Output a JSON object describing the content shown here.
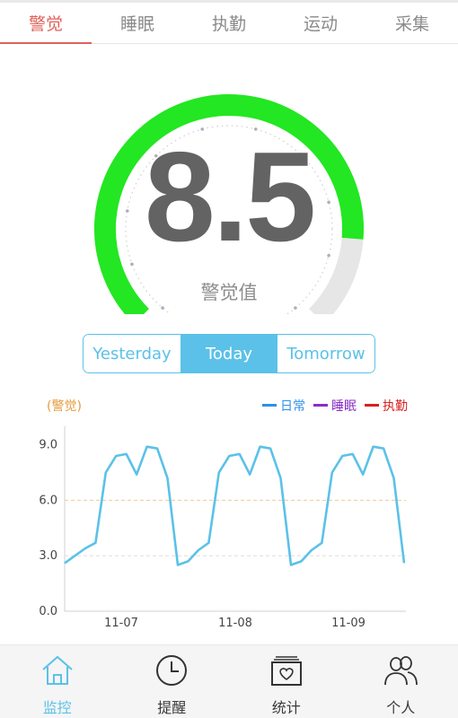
{
  "tabs": [
    {
      "label": "警觉",
      "active": true
    },
    {
      "label": "睡眠",
      "active": false
    },
    {
      "label": "执勤",
      "active": false
    },
    {
      "label": "运动",
      "active": false
    },
    {
      "label": "采集",
      "active": false
    }
  ],
  "gauge": {
    "value": "8.5",
    "value_fraction": 0.85,
    "label": "警觉值",
    "fill_color": "#22e722",
    "track_color": "#e6e6e6"
  },
  "day_selector": {
    "options": [
      "Yesterday",
      "Today",
      "Tomorrow"
    ],
    "selected": "Today"
  },
  "chart_data": {
    "type": "line",
    "ylabel": "(警觉)",
    "ylim": [
      0,
      10
    ],
    "yticks": [
      "9.0",
      "6.0",
      "3.0",
      "0.0"
    ],
    "ytick_values": [
      9,
      6,
      3,
      0
    ],
    "xticks": [
      "11-07",
      "11-08",
      "11-09"
    ],
    "threshold_lines": [
      6.0,
      3.0
    ],
    "legend_position": "top-right",
    "series": [
      {
        "name": "日常",
        "color": "#2f8fe6"
      },
      {
        "name": "睡眠",
        "color": "#8a2ec6"
      },
      {
        "name": "执勤",
        "color": "#d62020"
      }
    ],
    "line_color": "#5bc1e8",
    "values": [
      2.6,
      3.0,
      3.4,
      3.7,
      7.5,
      8.4,
      8.5,
      7.4,
      8.9,
      8.8,
      7.2,
      2.5,
      2.7,
      3.3,
      3.7,
      7.5,
      8.4,
      8.5,
      7.4,
      8.9,
      8.8,
      7.2,
      2.5,
      2.7,
      3.3,
      3.7,
      7.5,
      8.4,
      8.5,
      7.4,
      8.9,
      8.8,
      7.2,
      2.6
    ]
  },
  "bottom_nav": [
    {
      "label": "监控",
      "icon": "house-icon",
      "active": true
    },
    {
      "label": "提醒",
      "icon": "clock-icon",
      "active": false
    },
    {
      "label": "统计",
      "icon": "heart-calendar-icon",
      "active": false
    },
    {
      "label": "个人",
      "icon": "people-icon",
      "active": false
    }
  ]
}
